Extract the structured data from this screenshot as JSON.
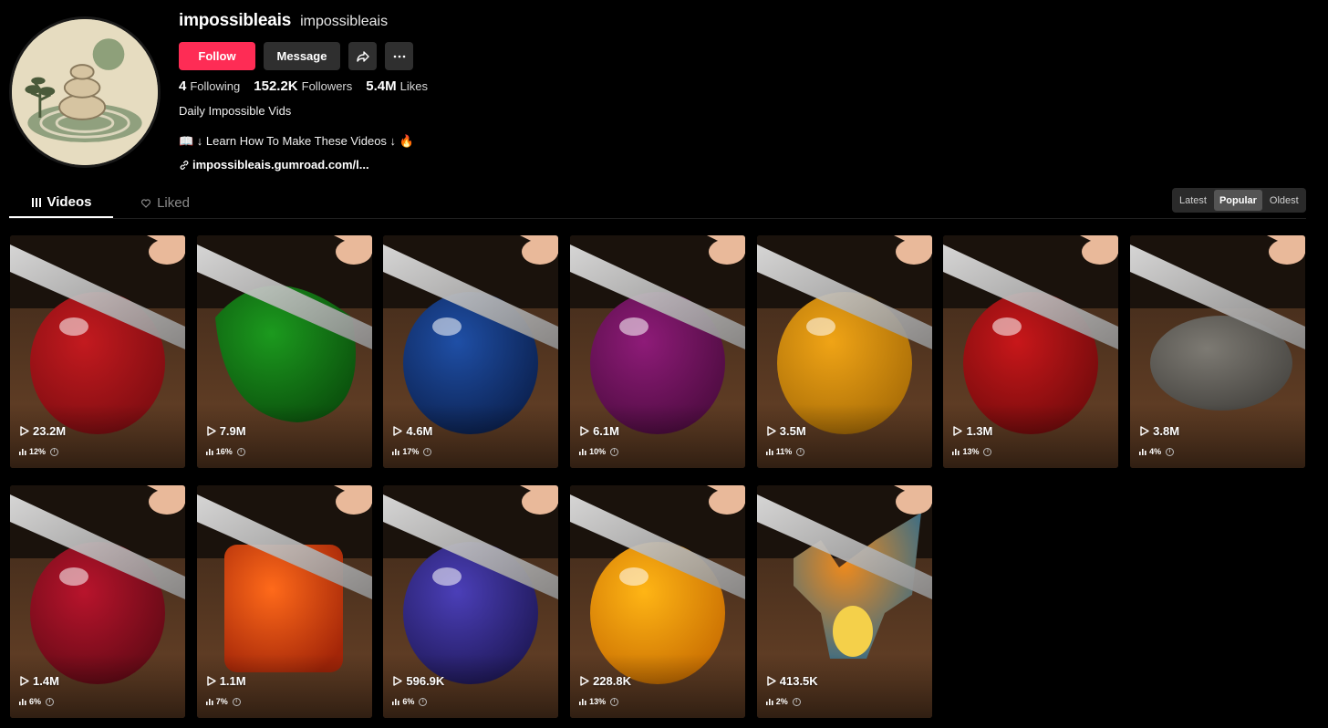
{
  "profile": {
    "unique_id": "impossibleais",
    "nickname": "impossibleais",
    "follow_label": "Follow",
    "message_label": "Message",
    "bio_line1": "Daily Impossible Vids",
    "bio_line2": "📖 ↓ Learn How To Make These Videos ↓ 🔥",
    "link": "impossibleais.gumroad.com/l..."
  },
  "stats": [
    {
      "value": "4",
      "label": "Following"
    },
    {
      "value": "152.2K",
      "label": "Followers"
    },
    {
      "value": "5.4M",
      "label": "Likes"
    }
  ],
  "tabs": {
    "videos": "Videos",
    "liked": "Liked"
  },
  "sort": {
    "latest": "Latest",
    "popular": "Popular",
    "oldest": "Oldest"
  },
  "videos": [
    {
      "views": "23.2M",
      "pct": "12%",
      "subject": "strawberry",
      "colors": [
        "#c31a1f",
        "#7a0c10"
      ],
      "knife": true
    },
    {
      "views": "7.9M",
      "pct": "16%",
      "subject": "green-leaf",
      "colors": [
        "#1c9a1e",
        "#0a4d0c"
      ],
      "knife": true
    },
    {
      "views": "4.6M",
      "pct": "17%",
      "subject": "blackberry",
      "colors": [
        "#1f4fa6",
        "#0a1e4a"
      ],
      "knife": true
    },
    {
      "views": "6.1M",
      "pct": "10%",
      "subject": "onion",
      "colors": [
        "#8e1b78",
        "#4a0b3d"
      ],
      "knife": true
    },
    {
      "views": "3.5M",
      "pct": "11%",
      "subject": "golden-apple",
      "colors": [
        "#f0a416",
        "#a56a06"
      ],
      "knife": true
    },
    {
      "views": "1.3M",
      "pct": "13%",
      "subject": "red-apple",
      "colors": [
        "#c8171a",
        "#6e0a0b"
      ],
      "knife": true
    },
    {
      "views": "3.8M",
      "pct": "4%",
      "subject": "stone",
      "colors": [
        "#7d7a73",
        "#45433f"
      ],
      "knife": true
    },
    {
      "views": "1.4M",
      "pct": "6%",
      "subject": "cherry-heart",
      "colors": [
        "#b8142c",
        "#5e0914"
      ],
      "knife": true
    },
    {
      "views": "1.1M",
      "pct": "7%",
      "subject": "lava-cube",
      "colors": [
        "#ff6a1a",
        "#a32508"
      ],
      "knife": true
    },
    {
      "views": "596.9K",
      "pct": "6%",
      "subject": "blue-sphere",
      "colors": [
        "#4b3fb8",
        "#1c1652"
      ],
      "knife": true
    },
    {
      "views": "228.8K",
      "pct": "13%",
      "subject": "yellow-strawberry",
      "colors": [
        "#ffb515",
        "#c66a00"
      ],
      "knife": true
    },
    {
      "views": "413.5K",
      "pct": "2%",
      "subject": "dragon-figure",
      "colors": [
        "#ef8a1c",
        "#2d6b8e"
      ],
      "knife": true
    }
  ]
}
